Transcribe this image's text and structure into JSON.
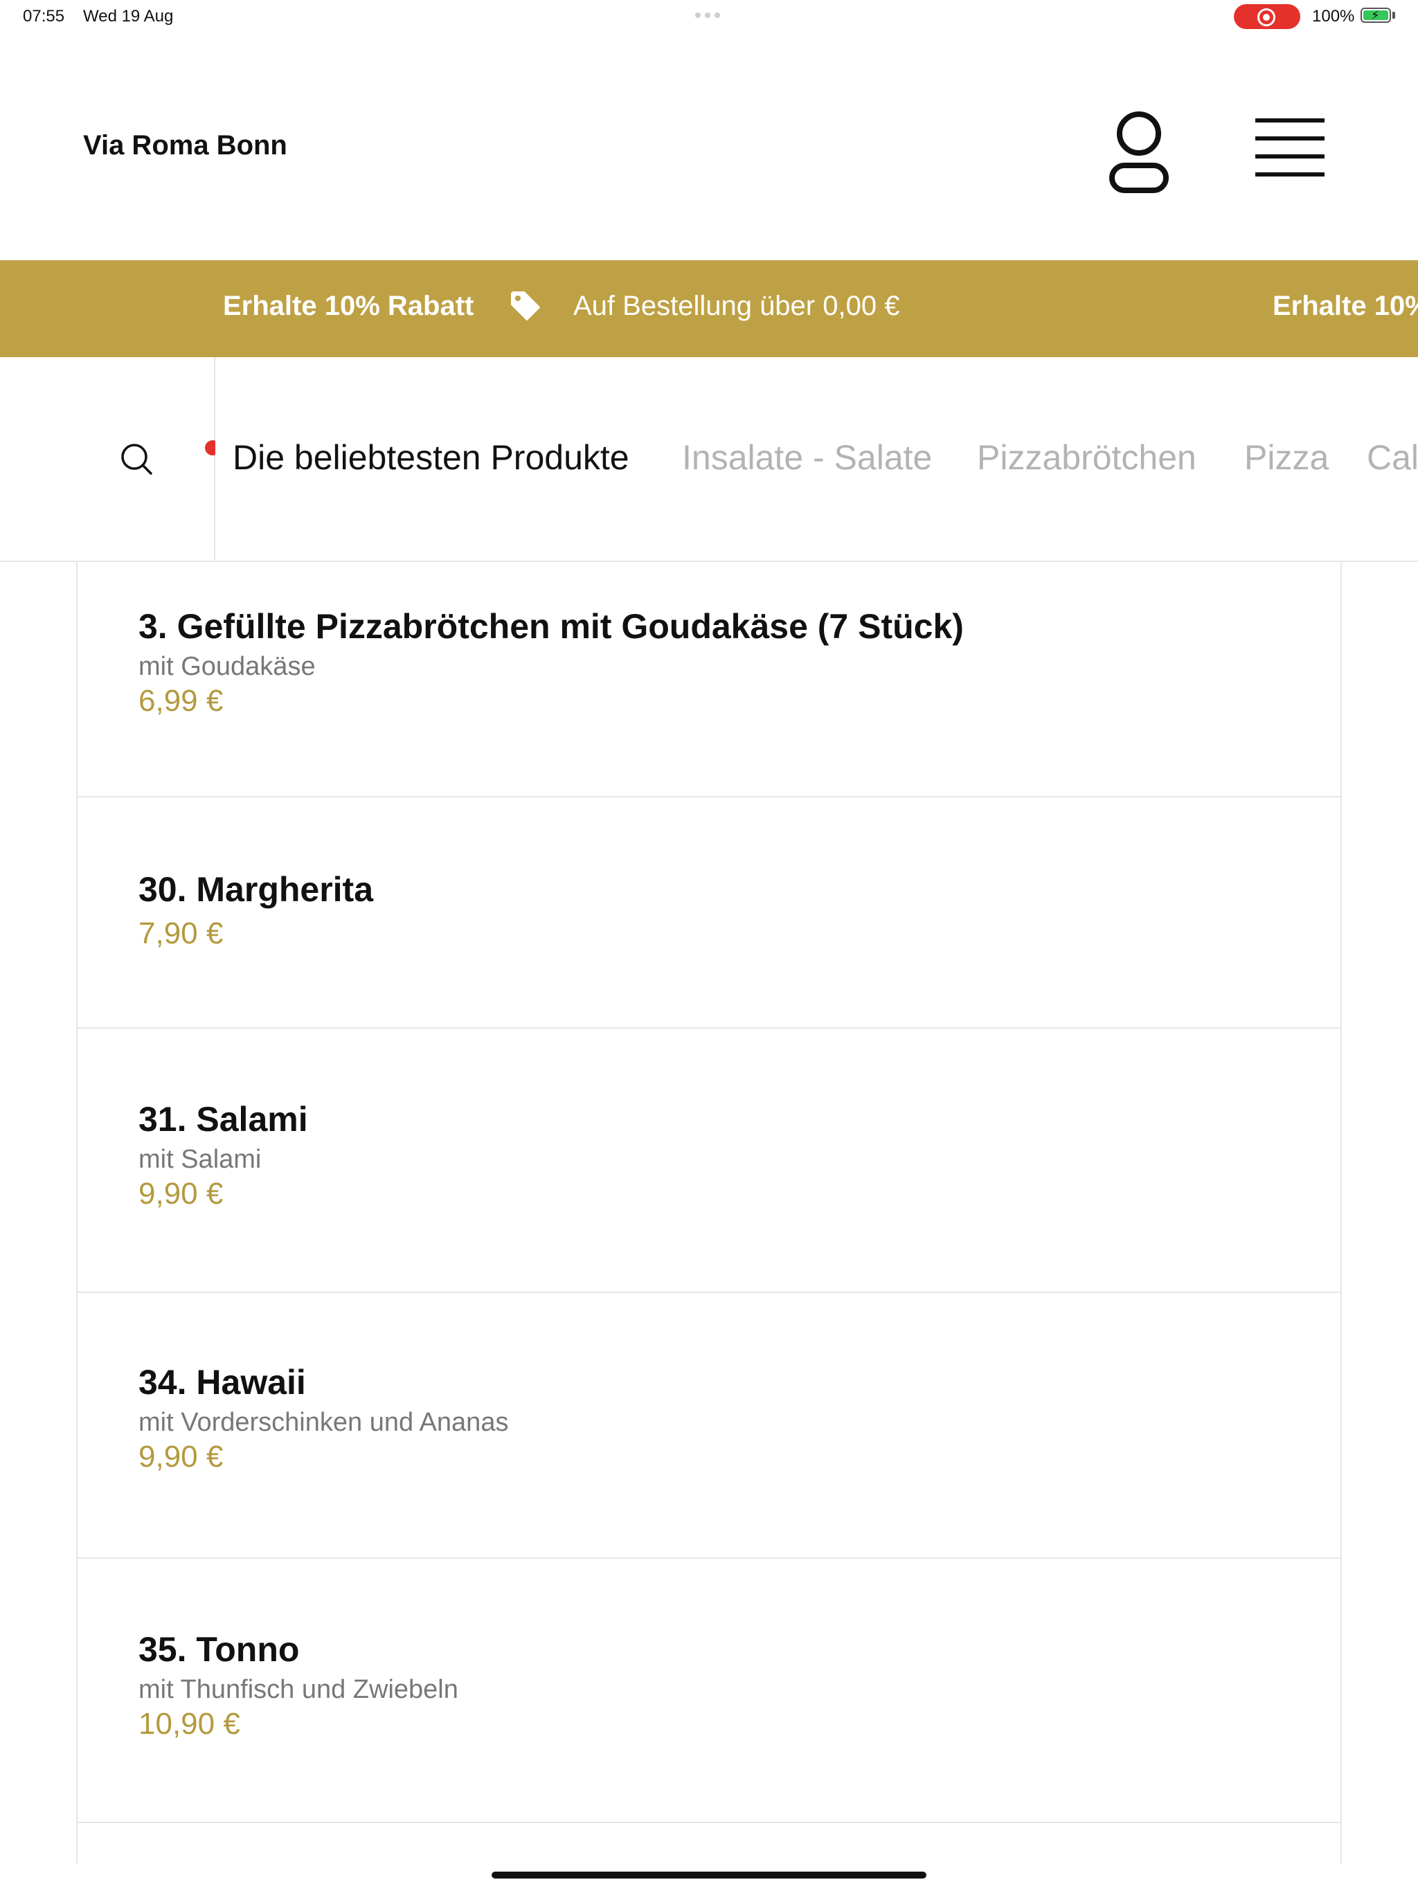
{
  "status_bar": {
    "time": "07:55",
    "date": "Wed 19 Aug",
    "battery": "100%"
  },
  "header": {
    "brand": "Via Roma Bonn",
    "user_icon": "user-icon",
    "menu_icon": "hamburger-menu-icon"
  },
  "promo": {
    "title": "Erhalte 10% Rabatt",
    "subtitle": "Auf Bestellung über 0,00 €",
    "title_repeat": "Erhalte 10%",
    "icon": "tag-icon",
    "color": "#bea145"
  },
  "categories": {
    "search_icon": "search-icon",
    "tabs": [
      {
        "label": "Die beliebtesten Produkte"
      },
      {
        "label": "Insalate - Salate"
      },
      {
        "label": "Pizzabrötchen"
      },
      {
        "label": "Pizza"
      },
      {
        "label": "Cal"
      }
    ]
  },
  "products": [
    {
      "name": "3. Gefüllte Pizzabrötchen mit Goudakäse  (7 Stück)",
      "desc": "mit Goudakäse",
      "price": "6,99 €"
    },
    {
      "name": "30. Margherita",
      "desc": "",
      "price": "7,90 €"
    },
    {
      "name": "31. Salami",
      "desc": "mit Salami",
      "price": "9,90 €"
    },
    {
      "name": "34. Hawaii",
      "desc": "mit Vorderschinken und Ananas",
      "price": "9,90 €"
    },
    {
      "name": "35. Tonno",
      "desc": "mit Thunfisch und Zwiebeln",
      "price": "10,90 €"
    }
  ],
  "colors": {
    "accent": "#bea145",
    "price": "#b49a3f",
    "inactive_tab": "#b3b3b3"
  }
}
